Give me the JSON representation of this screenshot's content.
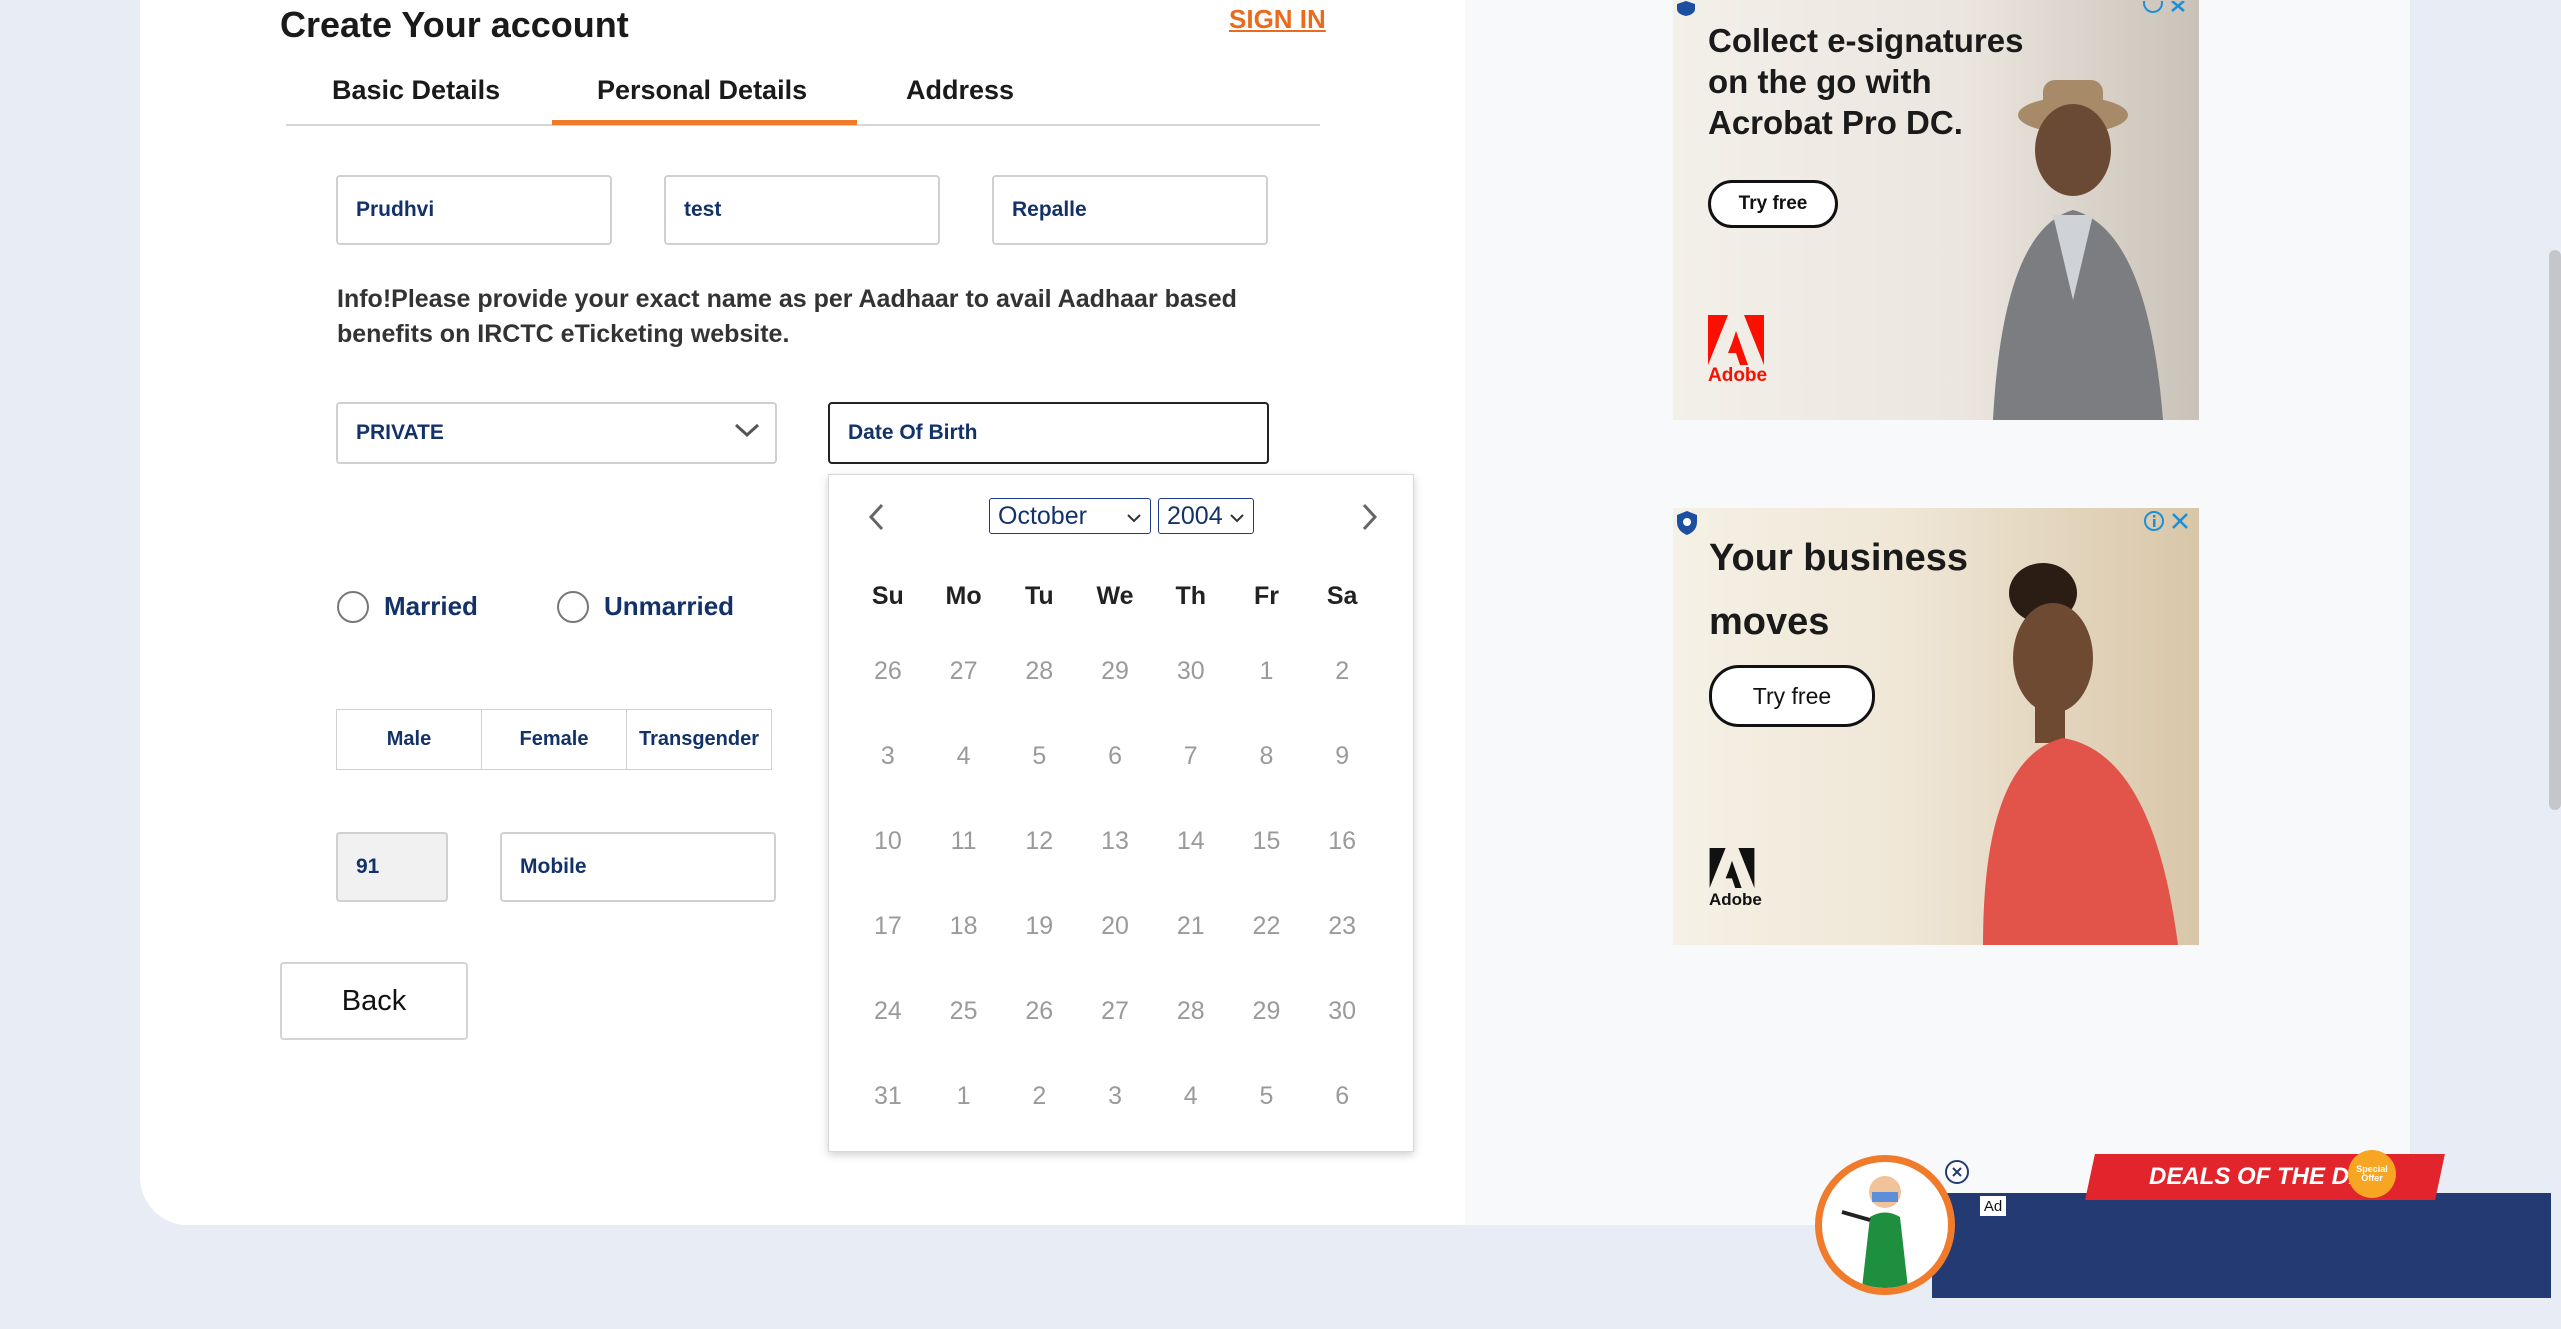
{
  "header": {
    "title": "Create Your account",
    "signin_label": "SIGN IN"
  },
  "tabs": [
    {
      "label": "Basic Details",
      "active": false
    },
    {
      "label": "Personal Details",
      "active": true
    },
    {
      "label": "Address",
      "active": false
    }
  ],
  "name_fields": {
    "first_name": "Prudhvi",
    "middle_name": "test",
    "last_name": "Repalle"
  },
  "info_text": "Info!Please provide your exact name as per Aadhaar to avail Aadhaar based benefits on IRCTC eTicketing website.",
  "occupation": {
    "selected": "PRIVATE"
  },
  "dob": {
    "placeholder": "Date Of Birth"
  },
  "marital": {
    "options": [
      "Married",
      "Unmarried"
    ]
  },
  "gender": {
    "options": [
      "Male",
      "Female",
      "Transgender"
    ]
  },
  "phone": {
    "country_code": "91",
    "mobile_placeholder": "Mobile"
  },
  "back_label": "Back",
  "calendar": {
    "month": "October",
    "year": "2004",
    "weekdays": [
      "Su",
      "Mo",
      "Tu",
      "We",
      "Th",
      "Fr",
      "Sa"
    ],
    "weeks": [
      [
        "26",
        "27",
        "28",
        "29",
        "30",
        "1",
        "2"
      ],
      [
        "3",
        "4",
        "5",
        "6",
        "7",
        "8",
        "9"
      ],
      [
        "10",
        "11",
        "12",
        "13",
        "14",
        "15",
        "16"
      ],
      [
        "17",
        "18",
        "19",
        "20",
        "21",
        "22",
        "23"
      ],
      [
        "24",
        "25",
        "26",
        "27",
        "28",
        "29",
        "30"
      ],
      [
        "31",
        "1",
        "2",
        "3",
        "4",
        "5",
        "6"
      ]
    ]
  },
  "ads": {
    "ad1": {
      "headline": "Collect e-signatures on the go with Acrobat Pro DC.",
      "button": "Try free",
      "brand": "Adobe"
    },
    "ad2": {
      "headline_line1": "Your business",
      "headline_line2": "moves",
      "button": "Try free",
      "brand": "Adobe"
    },
    "deals_banner": "DEALS OF THE DAY",
    "special_offer": "Special Offer",
    "ad_badge": "Ad"
  },
  "colors": {
    "accent": "#ef7b2b",
    "field_text": "#13326a",
    "deals_bar": "#233b72",
    "adobe_red": "#fa0f00"
  }
}
